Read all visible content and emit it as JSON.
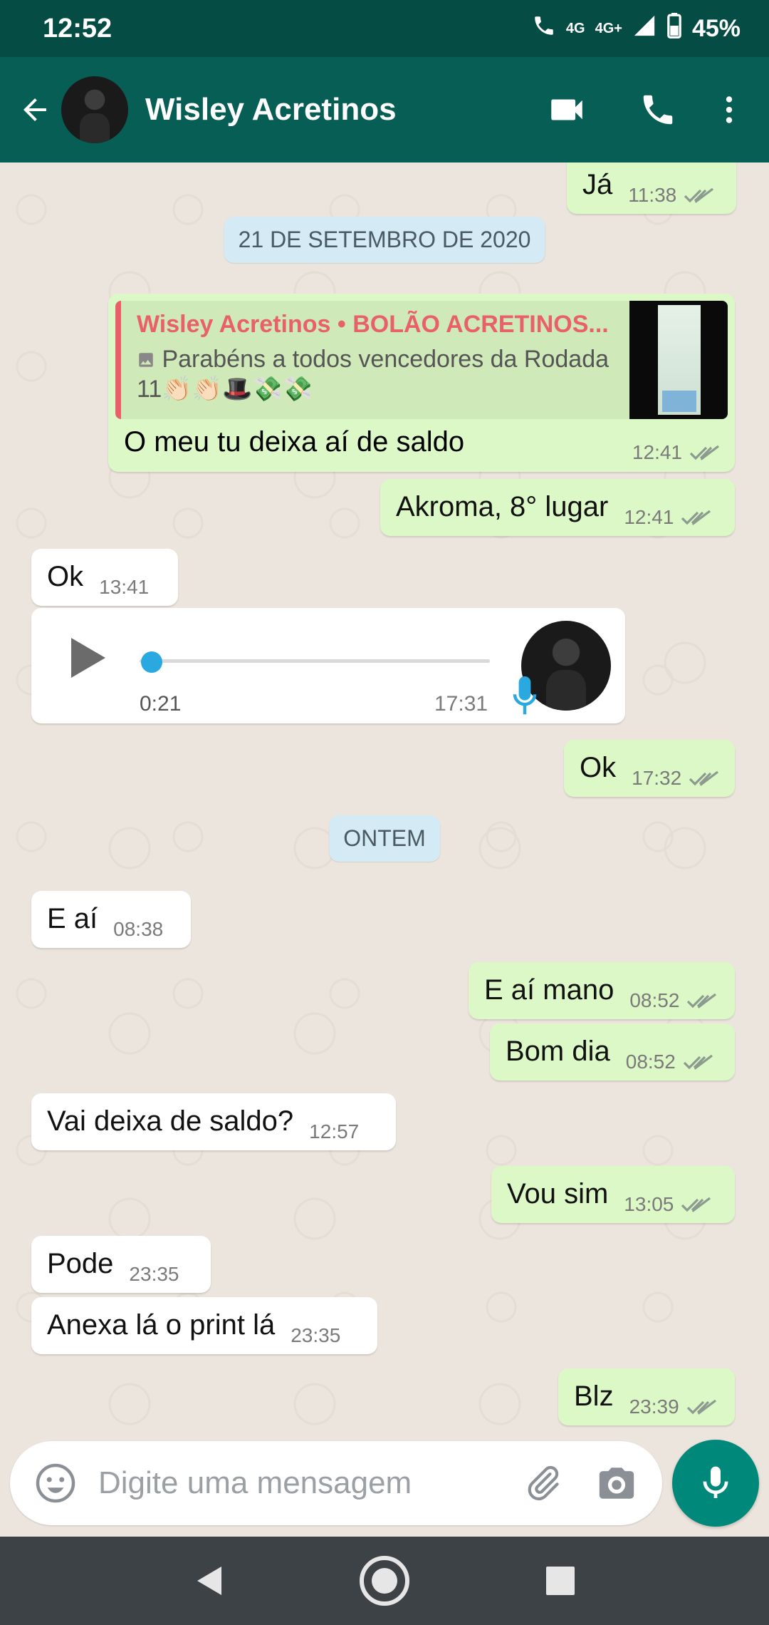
{
  "status_bar": {
    "time": "12:52",
    "network_left": "4G",
    "network_right": "4G+",
    "battery": "45%"
  },
  "header": {
    "contact_name": "Wisley Acretinos",
    "icons": [
      "back-arrow-icon",
      "video-call-icon",
      "phone-icon",
      "more-vert-icon"
    ]
  },
  "chat": {
    "top_message": {
      "text": "Já",
      "time": "11:38"
    },
    "date_separators": [
      "21 DE SETEMBRO DE 2020",
      "ONTEM"
    ],
    "reply_message": {
      "quoted_author": "Wisley Acretinos • BOLÃO ACRETINOS...",
      "quoted_text": "Parabéns a todos vencedores da Rodada 11👏🏻👏🏻🎩💸💸",
      "text": "O meu tu deixa aí de saldo",
      "time": "12:41"
    },
    "messages_a": [
      {
        "dir": "out",
        "text": "Akroma, 8° lugar",
        "time": "12:41"
      },
      {
        "dir": "in",
        "text": "Ok",
        "time": "13:41"
      }
    ],
    "voice_message": {
      "duration": "0:21",
      "time": "17:31",
      "progress": 0
    },
    "messages_b": [
      {
        "dir": "out",
        "text": "Ok",
        "time": "17:32"
      },
      {
        "dir": "in",
        "text": "E aí",
        "time": "08:38"
      },
      {
        "dir": "out",
        "text": "E aí mano",
        "time": "08:52"
      },
      {
        "dir": "out",
        "text": "Bom dia",
        "time": "08:52"
      },
      {
        "dir": "in",
        "text": "Vai deixa de saldo?",
        "time": "12:57"
      },
      {
        "dir": "out",
        "text": "Vou sim",
        "time": "13:05"
      },
      {
        "dir": "in",
        "text": "Pode",
        "time": "23:35"
      },
      {
        "dir": "in",
        "text": "Anexa lá o print lá",
        "time": "23:35"
      },
      {
        "dir": "out",
        "text": "Blz",
        "time": "23:39"
      }
    ]
  },
  "composer": {
    "placeholder": "Digite uma mensagem",
    "icons": [
      "emoji-icon",
      "attach-icon",
      "camera-icon",
      "mic-icon"
    ]
  },
  "colors": {
    "status_bar": "#054d44",
    "header": "#075e54",
    "outgoing_bubble": "#dcf8c6",
    "incoming_bubble": "#ffffff",
    "chat_bg": "#ece5dd",
    "accent": "#00897b",
    "read_ticks": "#8c9a8f"
  }
}
